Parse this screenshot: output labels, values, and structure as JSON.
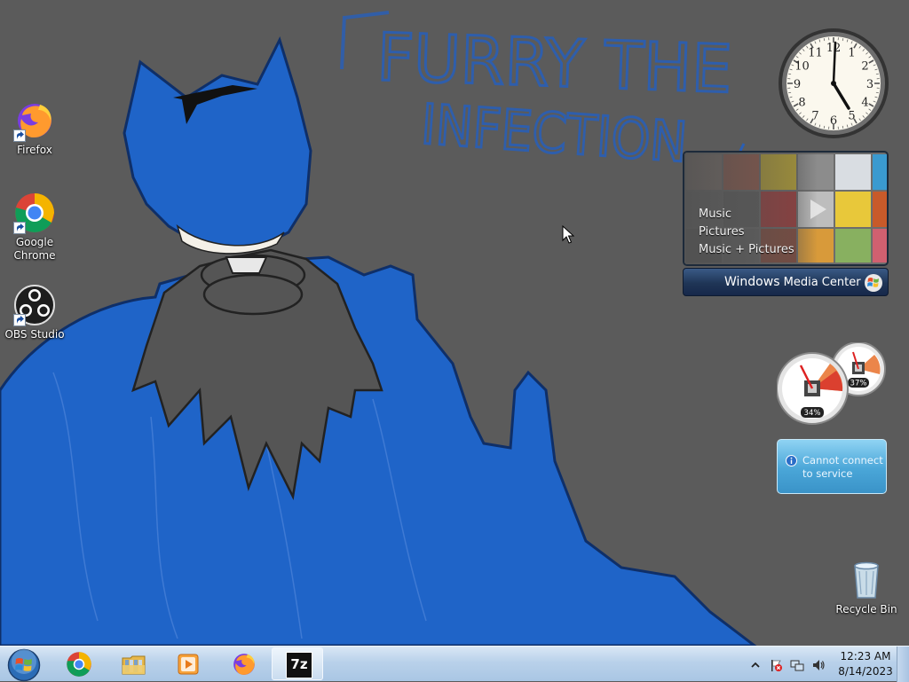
{
  "wallpaper": {
    "title_line1": "FURRY THE",
    "title_line2": "INFECTION"
  },
  "desktop_icons": [
    {
      "label": "Firefox",
      "icon": "firefox-icon"
    },
    {
      "label": "Google Chrome",
      "icon": "chrome-icon"
    },
    {
      "label": "OBS Studio",
      "icon": "obs-icon"
    }
  ],
  "recycle_bin": {
    "label": "Recycle Bin",
    "icon": "recycle-bin-icon"
  },
  "clock_gadget": {
    "numerals": [
      "12",
      "1",
      "2",
      "3",
      "4",
      "5",
      "6",
      "7",
      "8",
      "9",
      "10",
      "11"
    ],
    "time": "12:23"
  },
  "media_center": {
    "menu": [
      "Music",
      "Pictures",
      "Music + Pictures"
    ],
    "brand_part1": "Windows",
    "brand_part2": " Media Center"
  },
  "cpu_meter": {
    "cpu_percent": "34%",
    "memory_percent": "37%",
    "cpu_value": 34,
    "memory_value": 37
  },
  "weather": {
    "message": "Cannot connect to service",
    "icon": "info-icon"
  },
  "taskbar": {
    "pinned": [
      "start-orb-icon",
      "chrome-icon",
      "file-explorer-icon",
      "media-player-icon",
      "firefox-icon",
      "7zip-icon"
    ],
    "sevenzip_label": "7z",
    "tray_icons": [
      "show-hidden-icons-chevron",
      "action-center-flag-icon",
      "network-icon",
      "volume-icon"
    ],
    "time": "12:23 AM",
    "date": "8/14/2023"
  },
  "colors": {
    "wallpaper_gray": "#5b5b5b",
    "creature_blue": "#1f64c8",
    "taskbar": "#b9d1ea"
  }
}
